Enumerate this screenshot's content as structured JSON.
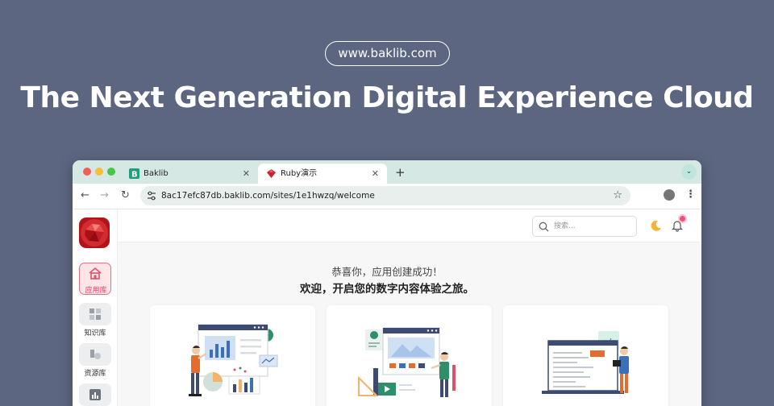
{
  "banner": {
    "url_label": "www.baklib.com",
    "headline": "The Next Generation Digital Experience Cloud"
  },
  "browser": {
    "tabs": [
      {
        "label": "Baklib",
        "icon": "baklib-favicon-icon",
        "active": false
      },
      {
        "label": "Ruby演示",
        "icon": "ruby-favicon-icon",
        "active": true
      }
    ],
    "address": "8ac17efc87db.baklib.com/sites/1e1hwzq/welcome"
  },
  "sidebar": {
    "items": [
      {
        "label": "应用库",
        "icon": "home-icon",
        "active": true
      },
      {
        "label": "知识库",
        "icon": "grid-icon",
        "active": false
      },
      {
        "label": "资源库",
        "icon": "shapes-icon",
        "active": false
      },
      {
        "label": "",
        "icon": "chart-icon",
        "active": false
      }
    ]
  },
  "header": {
    "search_placeholder": "搜索..."
  },
  "main": {
    "greeting": "恭喜你，应用创建成功！",
    "subtitle": "欢迎，开启您的数字内容体验之旅。"
  },
  "colors": {
    "page_bg": "#5c6680",
    "tabbar_bg": "#d6e8e4",
    "accent_pink": "#ef6d83",
    "notify_dot": "#f0507a"
  }
}
